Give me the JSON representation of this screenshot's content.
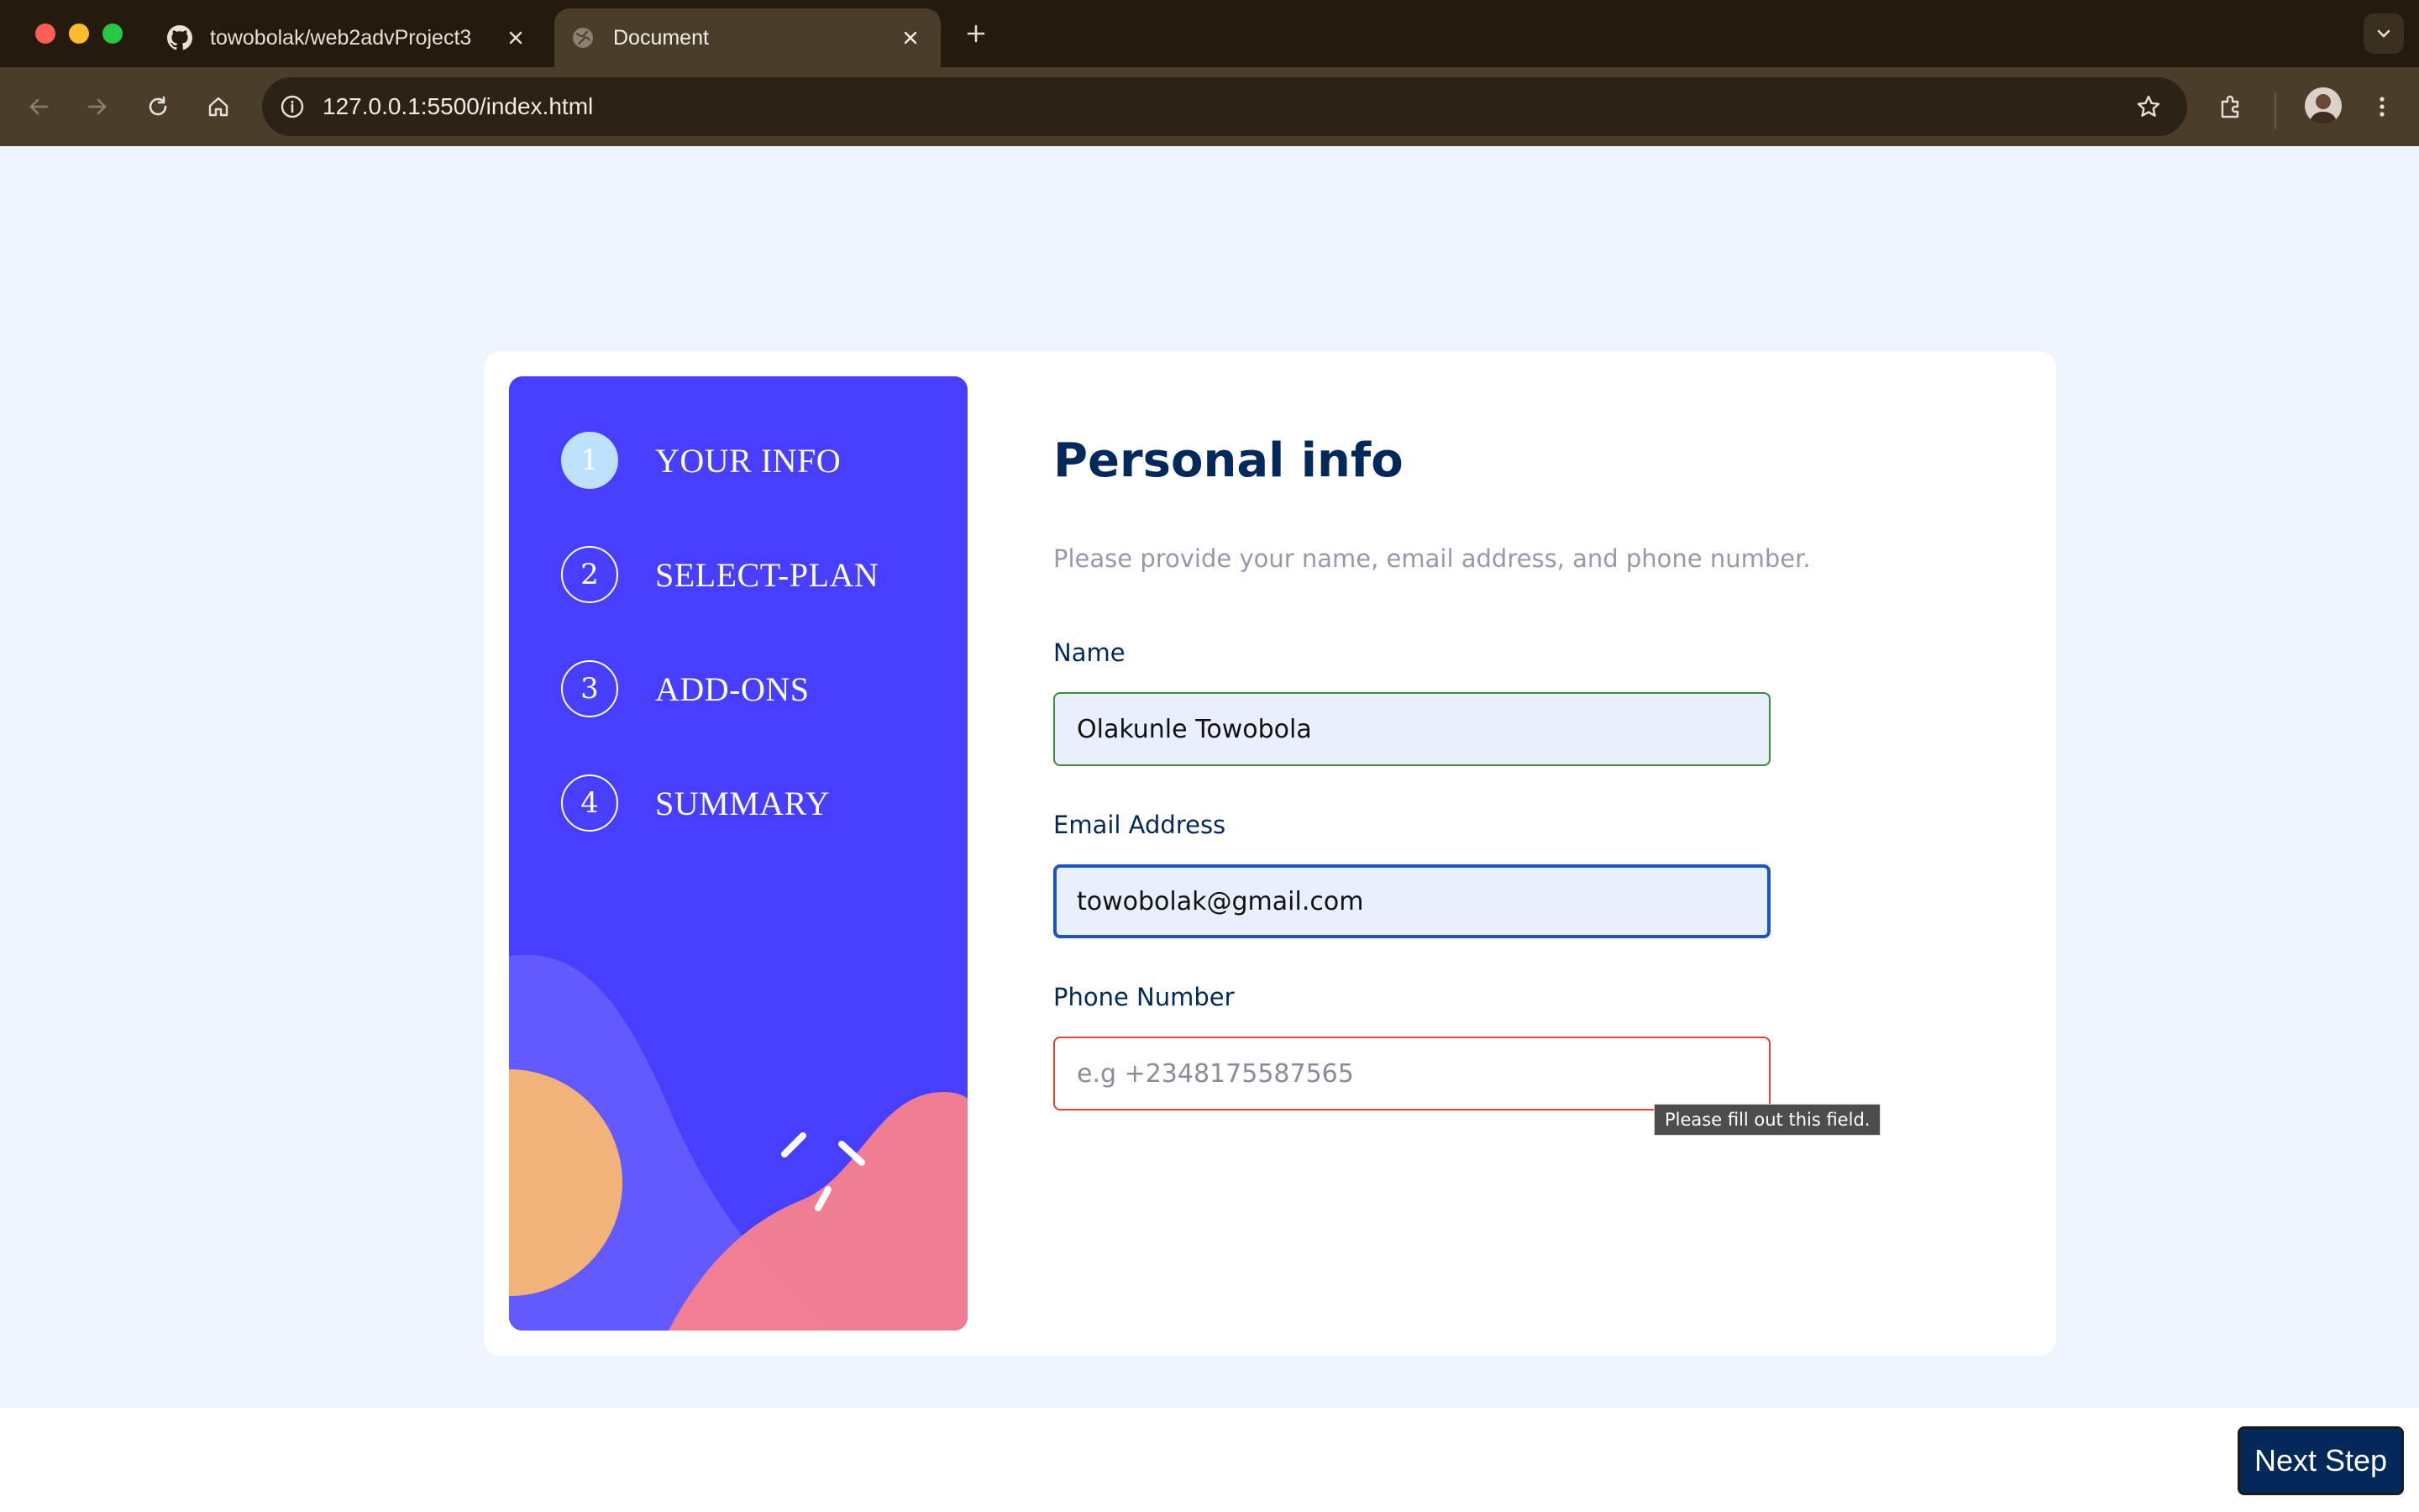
{
  "browser": {
    "tabs": [
      {
        "title": "towobolak/web2advProject3",
        "icon": "github-icon",
        "active": false
      },
      {
        "title": "Document",
        "icon": "globe-icon",
        "active": true
      }
    ],
    "url": "127.0.0.1:5500/index.html"
  },
  "sidebar": {
    "steps": [
      {
        "number": "1",
        "label": "YOUR INFO",
        "active": true
      },
      {
        "number": "2",
        "label": "SELECT-PLAN",
        "active": false
      },
      {
        "number": "3",
        "label": "ADD-ONS",
        "active": false
      },
      {
        "number": "4",
        "label": "SUMMARY",
        "active": false
      }
    ]
  },
  "form": {
    "title": "Personal info",
    "subtitle": "Please provide your name, email address, and phone number.",
    "name": {
      "label": "Name",
      "value": "Olakunle Towobola"
    },
    "email": {
      "label": "Email Address",
      "value": "towobolak@gmail.com"
    },
    "phone": {
      "label": "Phone Number",
      "value": "",
      "placeholder": "e.g +2348175587565"
    },
    "validation_tooltip": "Please fill out this field."
  },
  "footer": {
    "next_label": "Next Step"
  },
  "colors": {
    "sidebar": "#483eff",
    "heading": "#02295a",
    "muted": "#9699ab",
    "error": "#e0413a",
    "valid": "#3a8a3a",
    "focus": "#1f52c6",
    "page_bg": "#eff5ff"
  }
}
